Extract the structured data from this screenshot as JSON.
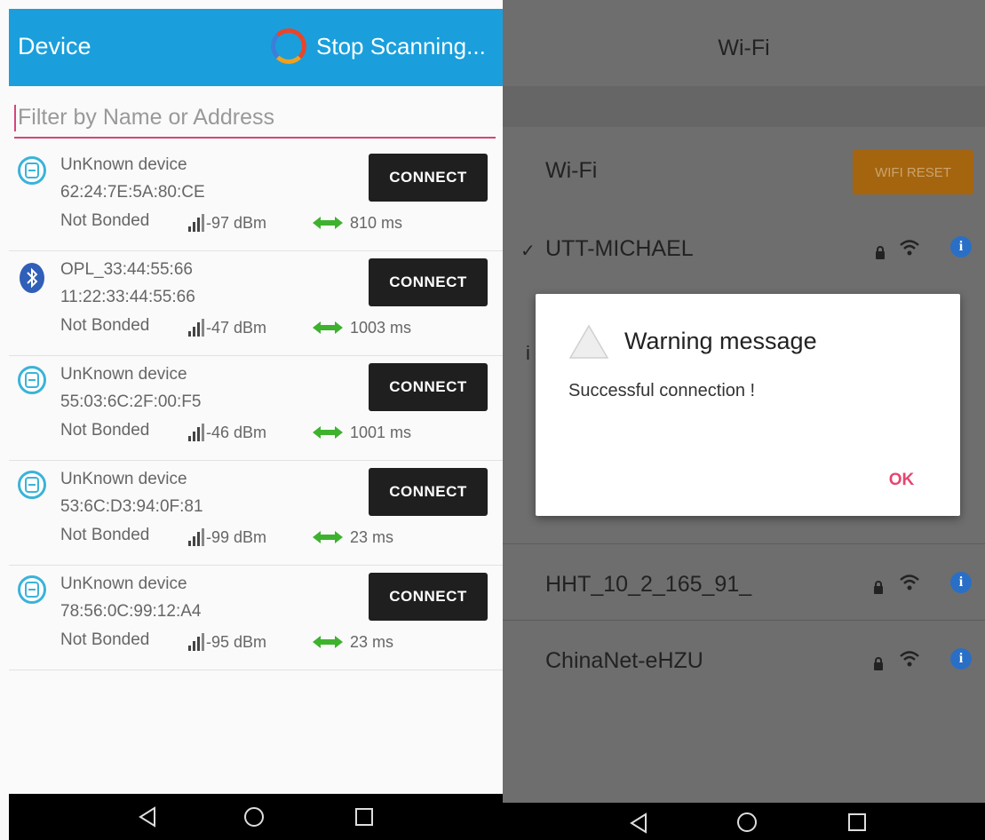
{
  "left": {
    "appbar": {
      "title": "Device",
      "stop_label": "Stop Scanning..."
    },
    "filter": {
      "placeholder": "Filter by Name or Address"
    },
    "devices": [
      {
        "name": "UnKnown device",
        "address": "62:24:7E:5A:80:CE",
        "bond": "Not Bonded",
        "rssi": "-97 dBm",
        "interval": "810 ms",
        "button": "CONNECT",
        "icon": "beacon-icon"
      },
      {
        "name": "OPL_33:44:55:66",
        "address": "11:22:33:44:55:66",
        "bond": "Not Bonded",
        "rssi": "-47 dBm",
        "interval": "1003 ms",
        "button": "CONNECT",
        "icon": "bluetooth-icon"
      },
      {
        "name": "UnKnown device",
        "address": "55:03:6C:2F:00:F5",
        "bond": "Not Bonded",
        "rssi": "-46 dBm",
        "interval": "1001 ms",
        "button": "CONNECT",
        "icon": "beacon-icon"
      },
      {
        "name": "UnKnown device",
        "address": "53:6C:D3:94:0F:81",
        "bond": "Not Bonded",
        "rssi": "-99 dBm",
        "interval": "23 ms",
        "button": "CONNECT",
        "icon": "beacon-icon"
      },
      {
        "name": "UnKnown device",
        "address": "78:56:0C:99:12:A4",
        "bond": "Not Bonded",
        "rssi": "-95 dBm",
        "interval": "23 ms",
        "button": "CONNECT",
        "icon": "beacon-icon"
      }
    ]
  },
  "right": {
    "title": "Wi-Fi",
    "wifi_label": "Wi-Fi",
    "reset_label": "WIFI RESET",
    "connected_network": "UTT-MICHAEL",
    "networks": [
      "HHT_10_2_165_91_",
      "ChinaNet-eHZU"
    ],
    "dialog": {
      "title": "Warning message",
      "message": "Successful connection !",
      "ok_label": "OK"
    }
  },
  "colors": {
    "appbar": "#1a9fdc",
    "accent": "#d6457a",
    "ok": "#e8456f",
    "reset": "#a5650f"
  }
}
